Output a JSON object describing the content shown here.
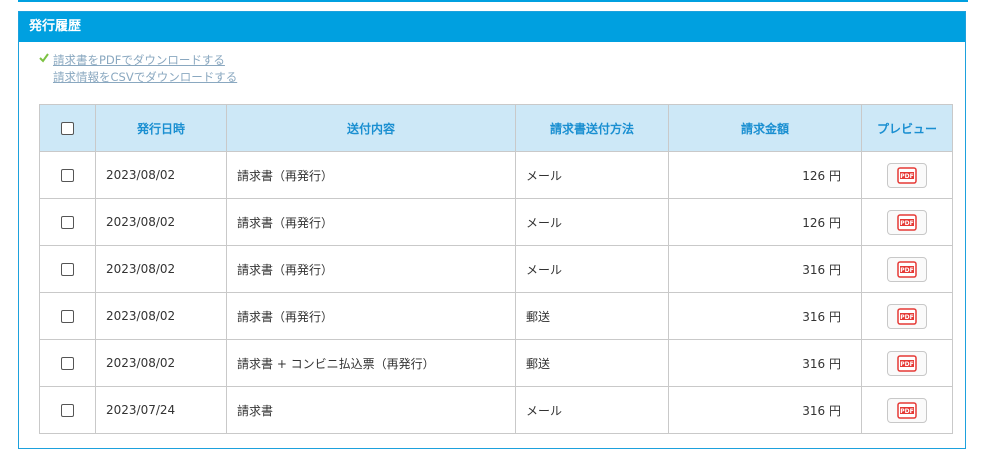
{
  "panel": {
    "title": "発行履歴",
    "download_pdf": "請求書をPDFでダウンロードする",
    "download_csv": "請求情報をCSVでダウンロードする"
  },
  "table": {
    "headers": {
      "date": "発行日時",
      "content": "送付内容",
      "method": "請求書送付方法",
      "amount": "請求金額",
      "preview": "プレビュー"
    },
    "rows": [
      {
        "date": "2023/08/02",
        "content": "請求書（再発行）",
        "method": "メール",
        "amount": "126 円",
        "checked": false
      },
      {
        "date": "2023/08/02",
        "content": "請求書（再発行）",
        "method": "メール",
        "amount": "126 円",
        "checked": false
      },
      {
        "date": "2023/08/02",
        "content": "請求書（再発行）",
        "method": "メール",
        "amount": "316 円",
        "checked": false
      },
      {
        "date": "2023/08/02",
        "content": "請求書（再発行）",
        "method": "郵送",
        "amount": "316 円",
        "checked": false
      },
      {
        "date": "2023/08/02",
        "content": "請求書 + コンビニ払込票（再発行）",
        "method": "郵送",
        "amount": "316 円",
        "checked": false
      },
      {
        "date": "2023/07/24",
        "content": "請求書",
        "method": "メール",
        "amount": "316 円",
        "checked": false
      }
    ]
  },
  "icons": {
    "check": "checkmark-icon",
    "pdf": "pdf-icon"
  },
  "colors": {
    "accent": "#00a0e0",
    "header_bg": "#cde8f7",
    "header_text": "#1a8fd1",
    "link": "#8aa8c0",
    "pdf_red": "#e53935",
    "check_green": "#7cc242"
  }
}
